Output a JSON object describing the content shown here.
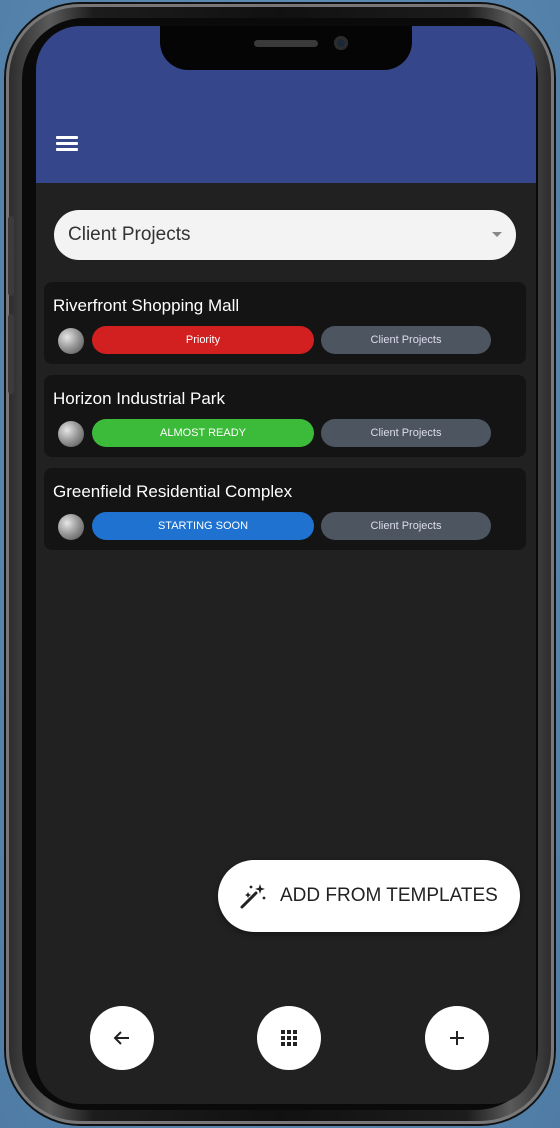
{
  "header": {
    "menu_icon": "hamburger-menu-icon",
    "background_color": "#35478a"
  },
  "filter": {
    "selected": "Client Projects"
  },
  "projects": [
    {
      "title": "Riverfront Shopping Mall",
      "status": "Priority",
      "status_color": "#d21f1f",
      "category": "Client Projects"
    },
    {
      "title": "Horizon Industrial Park",
      "status": "ALMOST READY",
      "status_color": "#3cbb3a",
      "category": "Client Projects"
    },
    {
      "title": "Greenfield Residential Complex",
      "status": "STARTING SOON",
      "status_color": "#1f72cf",
      "category": "Client Projects"
    }
  ],
  "templates_button": {
    "label": "ADD FROM TEMPLATES",
    "icon": "magic-wand-icon"
  },
  "bottom_nav": {
    "back_icon": "arrow-left-icon",
    "grid_icon": "grid-icon",
    "add_icon": "plus-icon"
  }
}
